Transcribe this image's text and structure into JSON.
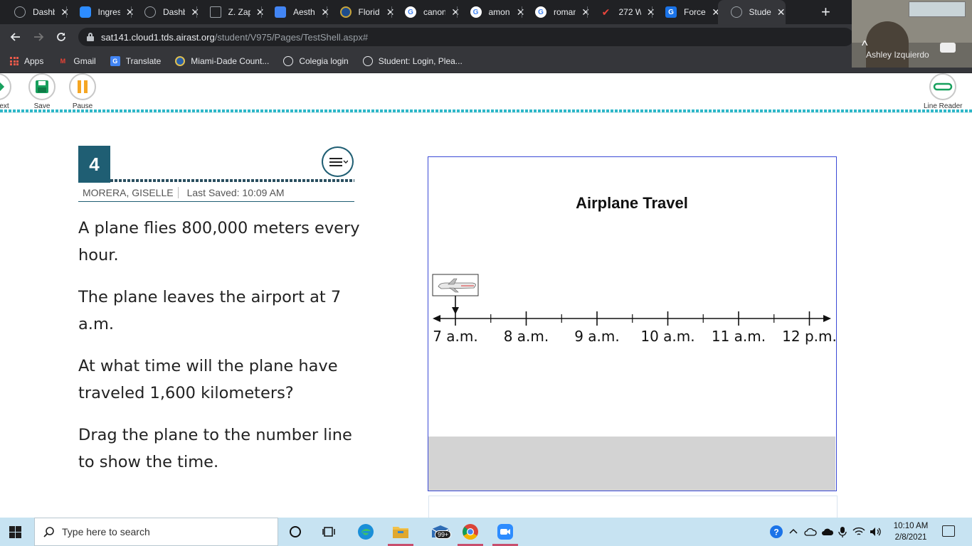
{
  "browser": {
    "tabs": [
      {
        "title": "Dashb",
        "favicon": "globe-icon",
        "color": "#9aa0a6"
      },
      {
        "title": "Ingres",
        "favicon": "zoom-icon",
        "color": "#2d8cff"
      },
      {
        "title": "Dashb",
        "favicon": "globe-icon",
        "color": "#9aa0a6"
      },
      {
        "title": "Z. Zap",
        "favicon": "badge-icon",
        "color": "#9aa0a6"
      },
      {
        "title": "Aesth",
        "favicon": "document-icon",
        "color": "#4285f4"
      },
      {
        "title": "Florid",
        "favicon": "seal-icon",
        "color": "#c9a43a"
      },
      {
        "title": "canon",
        "favicon": "google-icon",
        "color": "#ffffff"
      },
      {
        "title": "amon",
        "favicon": "google-icon",
        "color": "#ffffff"
      },
      {
        "title": "roman",
        "favicon": "google-icon",
        "color": "#ffffff"
      },
      {
        "title": "272 W",
        "favicon": "checkmark-icon",
        "color": "#e8453c"
      },
      {
        "title": "Force",
        "favicon": "g-icon",
        "color": "#1a73e8"
      },
      {
        "title": "Stude",
        "favicon": "globe-icon",
        "color": "#9aa0a6",
        "active": true
      }
    ],
    "url_host": "sat141.cloud1.tds.airast.org",
    "url_path": "/student/V975/Pages/TestShell.aspx#",
    "bookmarks": [
      {
        "label": "Apps",
        "icon": "apps-grid-icon"
      },
      {
        "label": "Gmail",
        "icon": "gmail-icon"
      },
      {
        "label": "Translate",
        "icon": "translate-icon"
      },
      {
        "label": "Miami-Dade Count...",
        "icon": "seal-icon"
      },
      {
        "label": "Colegia login",
        "icon": "globe-icon"
      },
      {
        "label": "Student: Login, Plea...",
        "icon": "globe-icon"
      }
    ]
  },
  "video": {
    "participant_name": "Ashley Izquierdo"
  },
  "test_toolbar": {
    "next_label": "ext",
    "save_label": "Save",
    "pause_label": "Pause",
    "line_reader_label": "Line Reader"
  },
  "question": {
    "number": "4",
    "student_name": "MORERA, GISELLE",
    "last_saved": "Last Saved: 10:09 AM",
    "paragraphs": [
      "A plane flies 800,000 meters every hour.",
      "The plane leaves the airport at 7 a.m.",
      "At what time will the plane have traveled 1,600 kilometers?",
      "Drag the plane to the number line to show the time."
    ]
  },
  "interaction": {
    "title": "Airplane Travel",
    "number_line": {
      "labels": [
        "7 a.m.",
        "8 a.m.",
        "9 a.m.",
        "10 a.m.",
        "11 a.m.",
        "12 p.m."
      ],
      "minor_ticks_between": 1,
      "plane_position_hours": 0
    }
  },
  "taskbar": {
    "search_placeholder": "Type here to search",
    "mail_badge": "99+",
    "time": "10:10 AM",
    "date": "2/8/2021"
  }
}
